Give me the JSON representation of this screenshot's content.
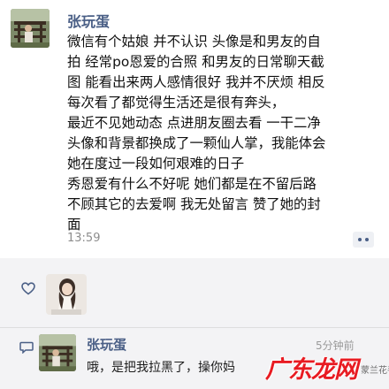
{
  "post": {
    "author": "张玩蛋",
    "lines": [
      "微信有个姑娘 并不认识 头像是和男友的自",
      "拍 经常po恩爱的合照 和男友的日常聊天截",
      "图 能看出来两人感情很好 我并不厌烦 相反",
      "每次看了都觉得生活还是很有奔头，",
      "最近不见她动态 点进朋友圈去看 一干二净",
      "头像和背景都换成了一颗仙人掌，我能体会",
      "她在度过一段如何艰难的日子",
      "秀恩爱有什么不好呢 她们都是在不留后路",
      "不顾其它的去爱啊 我无处留言 赞了她的封",
      "面"
    ],
    "time": "13:59"
  },
  "likes": {
    "icon": "heart-outline-icon"
  },
  "comment": {
    "icon": "comment-bubble-icon",
    "author": "张玩蛋",
    "time": "5分钟前",
    "text": "哦，是把我拉黑了，操你妈"
  },
  "watermark": {
    "main": "广东龙网",
    "sub": "蒙兰花手"
  },
  "colors": {
    "name_blue": "#4a5f86",
    "likes_background": "#f3f3f5",
    "watermark_red": "#e81b22"
  }
}
